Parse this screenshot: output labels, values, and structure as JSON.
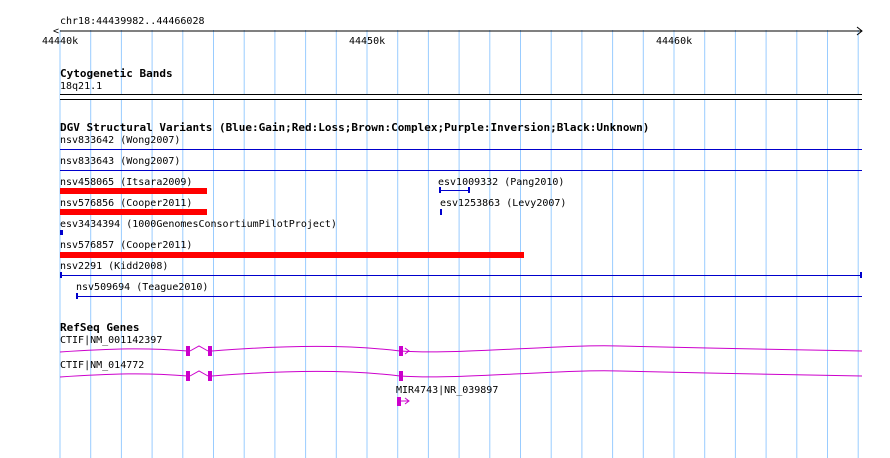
{
  "location": {
    "label": "chr18:44439982..44466028"
  },
  "ruler": {
    "ticks": [
      "44440k",
      "44450k",
      "44460k"
    ]
  },
  "tracks": {
    "cytoband": {
      "title": "Cytogenetic Bands",
      "band": "18q21.1"
    },
    "dgv": {
      "title": "DGV Structural Variants (Blue:Gain;Red:Loss;Brown:Complex;Purple:Inversion;Black:Unknown)",
      "features": [
        {
          "label": "nsv833642 (Wong2007)"
        },
        {
          "label": "nsv833643 (Wong2007)"
        },
        {
          "label": "nsv458065 (Itsara2009)"
        },
        {
          "label": "esv1009332 (Pang2010)"
        },
        {
          "label": "nsv576856 (Cooper2011)"
        },
        {
          "label": "esv1253863 (Levy2007)"
        },
        {
          "label": "esv3434394 (1000GenomesConsortiumPilotProject)"
        },
        {
          "label": "nsv576857 (Cooper2011)"
        },
        {
          "label": "nsv2291 (Kidd2008)"
        },
        {
          "label": "nsv509694 (Teague2010)"
        }
      ]
    },
    "refseq": {
      "title": "RefSeq Genes",
      "genes": [
        {
          "label": "CTIF|NM_001142397"
        },
        {
          "label": "CTIF|NM_014772"
        },
        {
          "label": "MIR4743|NR_039897"
        }
      ]
    }
  },
  "colors": {
    "gain": "#0000cc",
    "loss": "#ff0000",
    "gene": "#cc00cc",
    "grid": "#99ccff"
  }
}
